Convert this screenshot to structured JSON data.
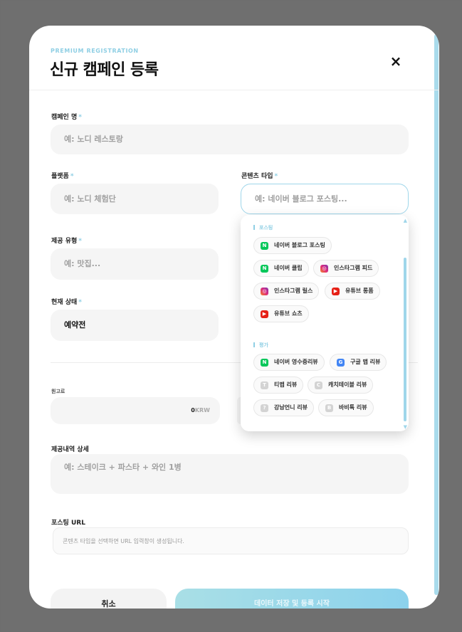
{
  "modal": {
    "eyebrow": "PREMIUM REGISTRATION",
    "title": "신규 캠페인 등록",
    "close_icon": "×"
  },
  "form": {
    "required_mark": "*",
    "campaign_name": {
      "label": "캠페인 명",
      "placeholder": "예: 노디 레스토랑"
    },
    "platform": {
      "label": "플랫폼",
      "placeholder": "예: 노디 체험단"
    },
    "content_type": {
      "label": "콘텐츠 타입",
      "placeholder": "예: 네이버 블로그 포스팅..."
    },
    "offer_type": {
      "label": "제공 유형",
      "placeholder": "예: 맛집..."
    },
    "status": {
      "label": "현재 상태",
      "value": "예약전"
    },
    "fee": {
      "label": "원고료",
      "value": "0",
      "currency": "KRW"
    },
    "offer_detail": {
      "label": "제공내역 상세",
      "placeholder": "예: 스테이크 + 파스타 + 와인 1병"
    },
    "posting_url": {
      "label": "포스팅 URL",
      "hint": "콘텐츠 타입을 선택하면 URL 입력창이 생성됩니다."
    }
  },
  "dropdown": {
    "groups": [
      {
        "title": "포스팅",
        "items": [
          {
            "label": "네이버 블로그 포스팅",
            "icon": "naver-icon",
            "glyph": "N"
          },
          {
            "label": "네이버 클립",
            "icon": "naver-icon",
            "glyph": "N"
          },
          {
            "label": "인스타그램 피드",
            "icon": "instagram-icon",
            "glyph": "◎"
          },
          {
            "label": "인스타그램 릴스",
            "icon": "instagram-icon",
            "glyph": "◎"
          },
          {
            "label": "유튜브 롱폼",
            "icon": "youtube-icon",
            "glyph": "▶"
          },
          {
            "label": "유튜브 쇼츠",
            "icon": "youtube-icon",
            "glyph": "▶"
          }
        ]
      },
      {
        "title": "평가",
        "items": [
          {
            "label": "네이버 영수증리뷰",
            "icon": "naver-icon",
            "glyph": "N"
          },
          {
            "label": "구글 맵 리뷰",
            "icon": "google-icon",
            "glyph": "G"
          },
          {
            "label": "티맵 리뷰",
            "icon": "tmap-icon",
            "glyph": "T"
          },
          {
            "label": "캐치테이블 리뷰",
            "icon": "catchtable-icon",
            "glyph": "C"
          },
          {
            "label": "강남언니 리뷰",
            "icon": "gangnamunni-icon",
            "glyph": "?"
          },
          {
            "label": "바비톡 리뷰",
            "icon": "babitalk-icon",
            "glyph": "B"
          }
        ]
      }
    ]
  },
  "actions": {
    "cancel": "취소",
    "submit": "데이터 저장 및 등록 시작"
  },
  "colors": {
    "accent": "#8fcfe4",
    "naver": "#03c75a",
    "youtube": "#e62117",
    "google": "#4285f4"
  }
}
